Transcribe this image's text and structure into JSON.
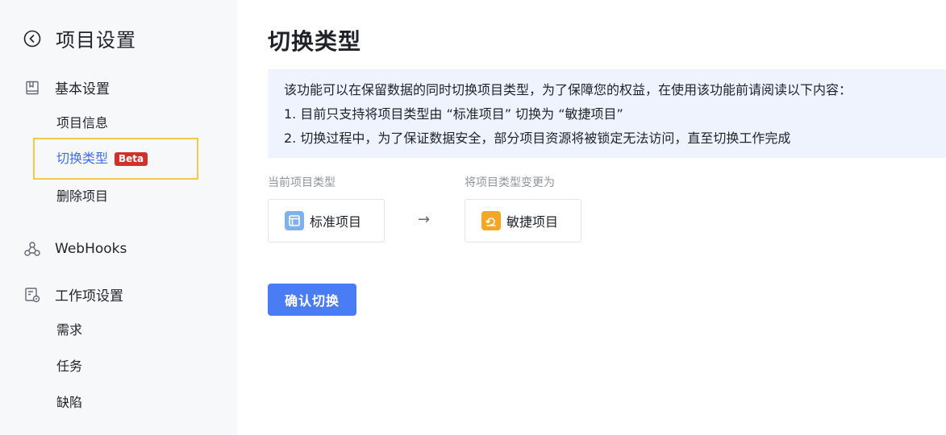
{
  "sidebar": {
    "title": "项目设置",
    "sections": {
      "basic": {
        "label": "基本设置",
        "items": [
          "项目信息",
          "切换类型",
          "删除项目"
        ],
        "active_badge": "Beta"
      },
      "webhooks": {
        "label": "WebHooks"
      },
      "work_items": {
        "label": "工作项设置",
        "items": [
          "需求",
          "任务",
          "缺陷"
        ]
      }
    }
  },
  "main": {
    "title": "切换类型",
    "notice": [
      "该功能可以在保留数据的同时切换项目类型，为了保障您的权益，在使用该功能前请阅读以下内容：",
      "1. 目前只支持将项目类型由 “标准项目” 切换为 “敏捷项目”",
      "2. 切换过程中，为了保证数据安全，部分项目资源将被锁定无法访问，直至切换工作完成"
    ],
    "current": {
      "label": "当前项目类型",
      "value": "标准项目",
      "icon": "standard-project-icon"
    },
    "arrow": "→",
    "target": {
      "label": "将项目类型变更为",
      "value": "敏捷项目",
      "icon": "agile-project-icon"
    },
    "confirm_label": "确认切换"
  },
  "colors": {
    "accent": "#3d6ef5",
    "button": "#4a7cf6",
    "beta": "#d0312d",
    "notice_bg": "#eef3fd",
    "highlight": "#f2c94c"
  }
}
